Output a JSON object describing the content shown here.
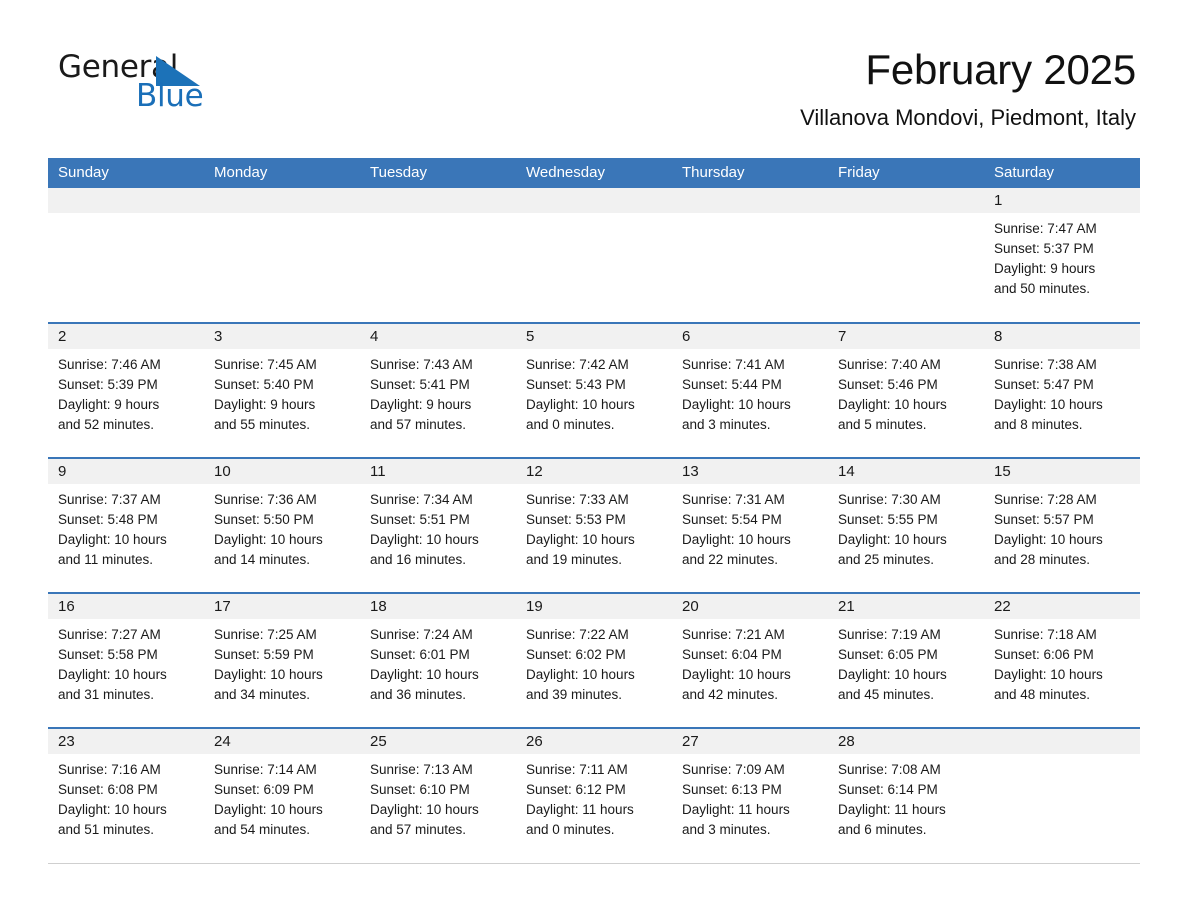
{
  "brand": {
    "name_part1": "General",
    "name_part2": "Blue",
    "triangle_color": "#1c72b8",
    "blue_text_color": "#1a6fb8"
  },
  "header": {
    "title": "February 2025",
    "subtitle": "Villanova Mondovi, Piedmont, Italy"
  },
  "theme": {
    "header_blue": "#3a76b8",
    "day_band_gray": "#f1f1f1",
    "border_gray": "#cfcfcf",
    "text_dark": "#1a1a1a"
  },
  "weekdays": [
    "Sunday",
    "Monday",
    "Tuesday",
    "Wednesday",
    "Thursday",
    "Friday",
    "Saturday"
  ],
  "weeks": [
    [
      {
        "day": "",
        "sunrise": "",
        "sunset": "",
        "daylight1": "",
        "daylight2": ""
      },
      {
        "day": "",
        "sunrise": "",
        "sunset": "",
        "daylight1": "",
        "daylight2": ""
      },
      {
        "day": "",
        "sunrise": "",
        "sunset": "",
        "daylight1": "",
        "daylight2": ""
      },
      {
        "day": "",
        "sunrise": "",
        "sunset": "",
        "daylight1": "",
        "daylight2": ""
      },
      {
        "day": "",
        "sunrise": "",
        "sunset": "",
        "daylight1": "",
        "daylight2": ""
      },
      {
        "day": "",
        "sunrise": "",
        "sunset": "",
        "daylight1": "",
        "daylight2": ""
      },
      {
        "day": "1",
        "sunrise": "Sunrise: 7:47 AM",
        "sunset": "Sunset: 5:37 PM",
        "daylight1": "Daylight: 9 hours",
        "daylight2": "and 50 minutes."
      }
    ],
    [
      {
        "day": "2",
        "sunrise": "Sunrise: 7:46 AM",
        "sunset": "Sunset: 5:39 PM",
        "daylight1": "Daylight: 9 hours",
        "daylight2": "and 52 minutes."
      },
      {
        "day": "3",
        "sunrise": "Sunrise: 7:45 AM",
        "sunset": "Sunset: 5:40 PM",
        "daylight1": "Daylight: 9 hours",
        "daylight2": "and 55 minutes."
      },
      {
        "day": "4",
        "sunrise": "Sunrise: 7:43 AM",
        "sunset": "Sunset: 5:41 PM",
        "daylight1": "Daylight: 9 hours",
        "daylight2": "and 57 minutes."
      },
      {
        "day": "5",
        "sunrise": "Sunrise: 7:42 AM",
        "sunset": "Sunset: 5:43 PM",
        "daylight1": "Daylight: 10 hours",
        "daylight2": "and 0 minutes."
      },
      {
        "day": "6",
        "sunrise": "Sunrise: 7:41 AM",
        "sunset": "Sunset: 5:44 PM",
        "daylight1": "Daylight: 10 hours",
        "daylight2": "and 3 minutes."
      },
      {
        "day": "7",
        "sunrise": "Sunrise: 7:40 AM",
        "sunset": "Sunset: 5:46 PM",
        "daylight1": "Daylight: 10 hours",
        "daylight2": "and 5 minutes."
      },
      {
        "day": "8",
        "sunrise": "Sunrise: 7:38 AM",
        "sunset": "Sunset: 5:47 PM",
        "daylight1": "Daylight: 10 hours",
        "daylight2": "and 8 minutes."
      }
    ],
    [
      {
        "day": "9",
        "sunrise": "Sunrise: 7:37 AM",
        "sunset": "Sunset: 5:48 PM",
        "daylight1": "Daylight: 10 hours",
        "daylight2": "and 11 minutes."
      },
      {
        "day": "10",
        "sunrise": "Sunrise: 7:36 AM",
        "sunset": "Sunset: 5:50 PM",
        "daylight1": "Daylight: 10 hours",
        "daylight2": "and 14 minutes."
      },
      {
        "day": "11",
        "sunrise": "Sunrise: 7:34 AM",
        "sunset": "Sunset: 5:51 PM",
        "daylight1": "Daylight: 10 hours",
        "daylight2": "and 16 minutes."
      },
      {
        "day": "12",
        "sunrise": "Sunrise: 7:33 AM",
        "sunset": "Sunset: 5:53 PM",
        "daylight1": "Daylight: 10 hours",
        "daylight2": "and 19 minutes."
      },
      {
        "day": "13",
        "sunrise": "Sunrise: 7:31 AM",
        "sunset": "Sunset: 5:54 PM",
        "daylight1": "Daylight: 10 hours",
        "daylight2": "and 22 minutes."
      },
      {
        "day": "14",
        "sunrise": "Sunrise: 7:30 AM",
        "sunset": "Sunset: 5:55 PM",
        "daylight1": "Daylight: 10 hours",
        "daylight2": "and 25 minutes."
      },
      {
        "day": "15",
        "sunrise": "Sunrise: 7:28 AM",
        "sunset": "Sunset: 5:57 PM",
        "daylight1": "Daylight: 10 hours",
        "daylight2": "and 28 minutes."
      }
    ],
    [
      {
        "day": "16",
        "sunrise": "Sunrise: 7:27 AM",
        "sunset": "Sunset: 5:58 PM",
        "daylight1": "Daylight: 10 hours",
        "daylight2": "and 31 minutes."
      },
      {
        "day": "17",
        "sunrise": "Sunrise: 7:25 AM",
        "sunset": "Sunset: 5:59 PM",
        "daylight1": "Daylight: 10 hours",
        "daylight2": "and 34 minutes."
      },
      {
        "day": "18",
        "sunrise": "Sunrise: 7:24 AM",
        "sunset": "Sunset: 6:01 PM",
        "daylight1": "Daylight: 10 hours",
        "daylight2": "and 36 minutes."
      },
      {
        "day": "19",
        "sunrise": "Sunrise: 7:22 AM",
        "sunset": "Sunset: 6:02 PM",
        "daylight1": "Daylight: 10 hours",
        "daylight2": "and 39 minutes."
      },
      {
        "day": "20",
        "sunrise": "Sunrise: 7:21 AM",
        "sunset": "Sunset: 6:04 PM",
        "daylight1": "Daylight: 10 hours",
        "daylight2": "and 42 minutes."
      },
      {
        "day": "21",
        "sunrise": "Sunrise: 7:19 AM",
        "sunset": "Sunset: 6:05 PM",
        "daylight1": "Daylight: 10 hours",
        "daylight2": "and 45 minutes."
      },
      {
        "day": "22",
        "sunrise": "Sunrise: 7:18 AM",
        "sunset": "Sunset: 6:06 PM",
        "daylight1": "Daylight: 10 hours",
        "daylight2": "and 48 minutes."
      }
    ],
    [
      {
        "day": "23",
        "sunrise": "Sunrise: 7:16 AM",
        "sunset": "Sunset: 6:08 PM",
        "daylight1": "Daylight: 10 hours",
        "daylight2": "and 51 minutes."
      },
      {
        "day": "24",
        "sunrise": "Sunrise: 7:14 AM",
        "sunset": "Sunset: 6:09 PM",
        "daylight1": "Daylight: 10 hours",
        "daylight2": "and 54 minutes."
      },
      {
        "day": "25",
        "sunrise": "Sunrise: 7:13 AM",
        "sunset": "Sunset: 6:10 PM",
        "daylight1": "Daylight: 10 hours",
        "daylight2": "and 57 minutes."
      },
      {
        "day": "26",
        "sunrise": "Sunrise: 7:11 AM",
        "sunset": "Sunset: 6:12 PM",
        "daylight1": "Daylight: 11 hours",
        "daylight2": "and 0 minutes."
      },
      {
        "day": "27",
        "sunrise": "Sunrise: 7:09 AM",
        "sunset": "Sunset: 6:13 PM",
        "daylight1": "Daylight: 11 hours",
        "daylight2": "and 3 minutes."
      },
      {
        "day": "28",
        "sunrise": "Sunrise: 7:08 AM",
        "sunset": "Sunset: 6:14 PM",
        "daylight1": "Daylight: 11 hours",
        "daylight2": "and 6 minutes."
      },
      {
        "day": "",
        "sunrise": "",
        "sunset": "",
        "daylight1": "",
        "daylight2": ""
      }
    ]
  ]
}
